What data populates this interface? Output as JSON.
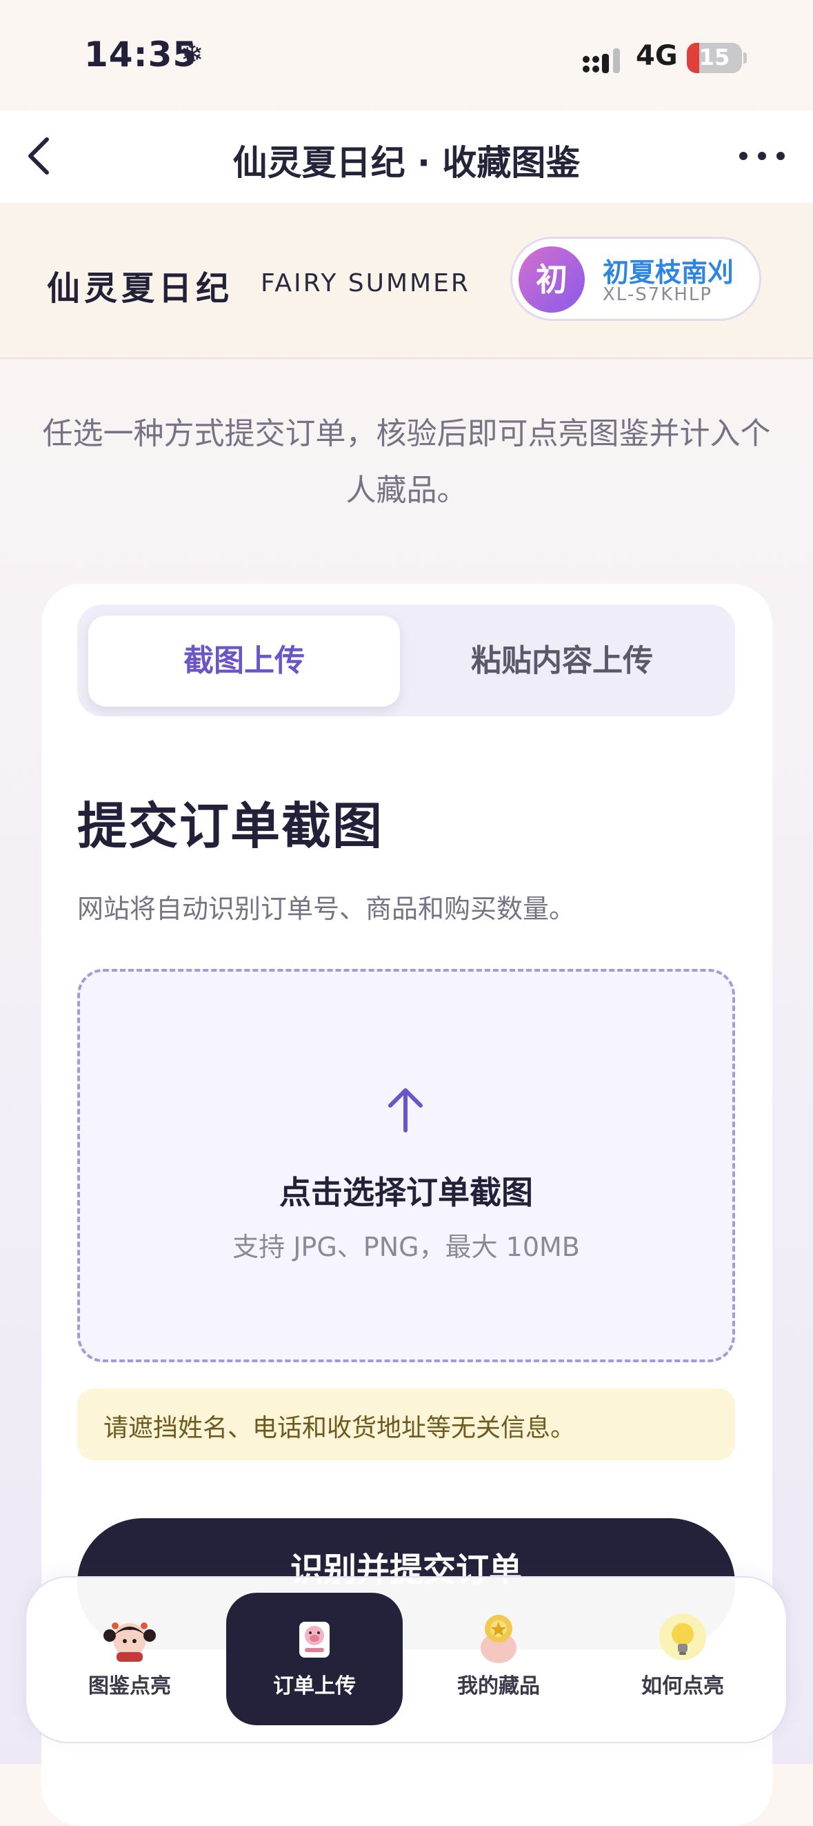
{
  "status_bar": {
    "time": "14:35",
    "snow": "❄",
    "network": "4G",
    "battery": "15"
  },
  "nav": {
    "title": "仙灵夏日纪 · 收藏图鉴"
  },
  "brand": {
    "name_cn": "仙灵夏日纪",
    "name_en": "FAIRY SUMMER"
  },
  "user": {
    "avatar_char": "初",
    "name": "初夏枝南刈",
    "id": "XL-S7KHLP"
  },
  "intro": {
    "text": "任选一种方式提交订单，核验后即可点亮图鉴并计入个人藏品。"
  },
  "tabs": {
    "active": "截图上传",
    "inactive": "粘贴内容上传"
  },
  "section": {
    "title": "提交订单截图",
    "desc": "网站将自动识别订单号、商品和购买数量。"
  },
  "dropzone": {
    "title": "点击选择订单截图",
    "hint": "支持 JPG、PNG，最大 10MB"
  },
  "notice": {
    "text": "请遮挡姓名、电话和收货地址等无关信息。"
  },
  "submit": {
    "label": "识别并提交订单"
  },
  "bottom_nav": {
    "items": [
      {
        "label": "图鉴点亮",
        "icon": "doll-icon"
      },
      {
        "label": "订单上传",
        "icon": "pig-icon"
      },
      {
        "label": "我的藏品",
        "icon": "collection-icon"
      },
      {
        "label": "如何点亮",
        "icon": "lightbulb-icon"
      }
    ]
  },
  "colors": {
    "accent": "#6a55c9",
    "dark": "#24223a",
    "user_name": "#2f86e0",
    "notice_bg": "#fcf5d7"
  }
}
